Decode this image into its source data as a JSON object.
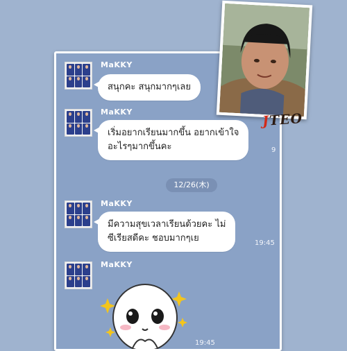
{
  "messages": [
    {
      "sender": "MaKKY",
      "text": [
        "สนุกคะ สนุกมากๆเลย"
      ]
    },
    {
      "sender": "MaKKY",
      "text": [
        "เริ่มอยากเรียนมากขึ้น อยากเข้าใจ",
        "อะไรๆมากขึ้นคะ"
      ],
      "time": "9"
    },
    {
      "sender": "MaKKY",
      "text": [
        "มีความสุขเวลาเรียนด้วยคะ ไม่",
        "ซีเรียสดีคะ ชอบมากๆเย"
      ],
      "time": "19:45"
    },
    {
      "sender": "MaKKY",
      "sticker": "line-moon-sparkle-sticker",
      "time": "19:45"
    }
  ],
  "date_separator": "12/26(木)",
  "overlay_signature": {
    "prefix": "J",
    "rest": "TEO"
  },
  "colors": {
    "chat_background": "#8aa2c6",
    "bubble": "#ffffff",
    "page_background": "#9fb3cf",
    "signature_red": "#d12b1a"
  }
}
